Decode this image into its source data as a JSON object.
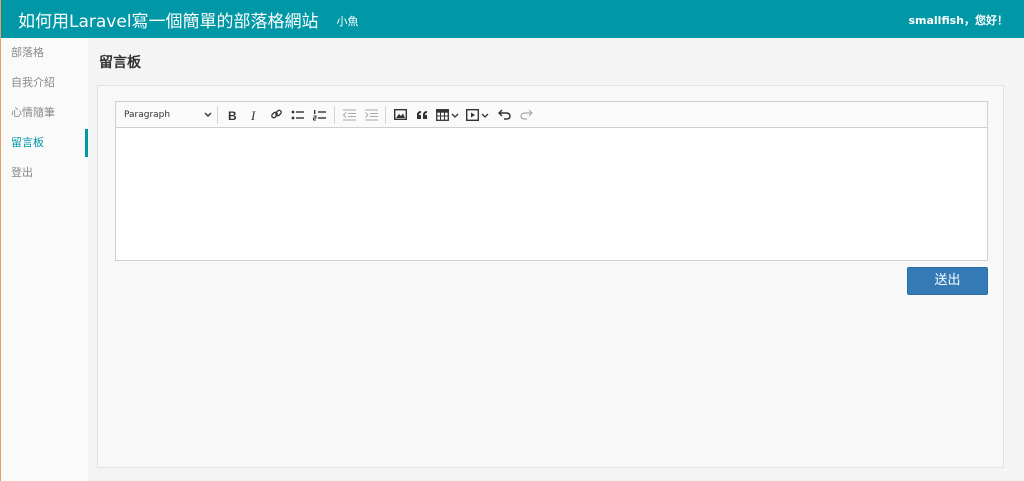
{
  "header": {
    "title": "如何用Laravel寫一個簡單的部落格網站",
    "subtitle": "小魚",
    "greeting": "smallfish，您好！"
  },
  "sidebar": {
    "items": [
      {
        "label": "部落格"
      },
      {
        "label": "自我介紹"
      },
      {
        "label": "心情隨筆"
      },
      {
        "label": "留言板"
      },
      {
        "label": "登出"
      }
    ],
    "active_index": 3
  },
  "page": {
    "title": "留言板"
  },
  "editor": {
    "format_value": "Paragraph",
    "content": "",
    "toolbar_icons": [
      "bold-icon",
      "italic-icon",
      "link-icon",
      "bulleted-list-icon",
      "numbered-list-icon",
      "outdent-icon",
      "indent-icon",
      "image-icon",
      "quote-icon",
      "table-icon",
      "media-icon",
      "undo-icon",
      "redo-icon"
    ]
  },
  "form": {
    "submit_label": "送出"
  },
  "colors": {
    "accent": "#0097a7",
    "primary_button": "#337ab7",
    "left_border": "#e8a25a"
  }
}
